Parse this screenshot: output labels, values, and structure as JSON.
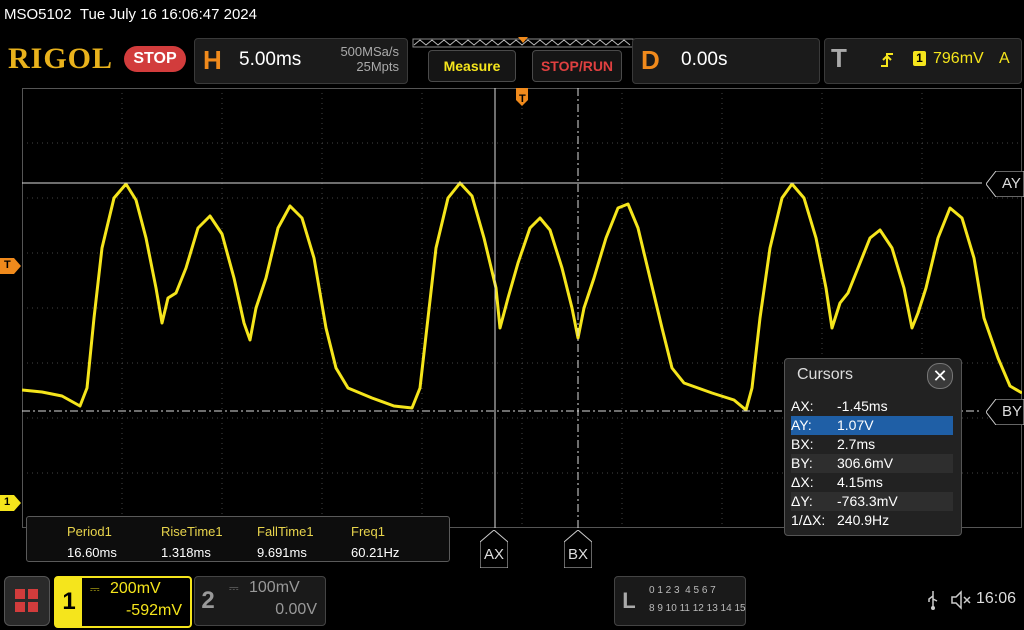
{
  "status": {
    "model": "MSO5102",
    "datetime": "Tue July 16 16:06:47 2024"
  },
  "header": {
    "brand": "RIGOL",
    "run_state": "STOP",
    "horizontal": {
      "letter": "H",
      "timebase": "5.00ms",
      "sample_rate": "500MSa/s",
      "memory_depth": "25Mpts"
    },
    "measure_label": "Measure",
    "stoprun_label": "STOP/RUN",
    "delay": {
      "letter": "D",
      "value": "0.00s"
    },
    "trigger": {
      "letter": "T",
      "source": "1",
      "level": "796mV",
      "mode": "A"
    }
  },
  "screen": {
    "trigger_marker_top": "T",
    "trigger_level_marker": "T",
    "channel1_marker": "1",
    "cursor_labels": {
      "ay": "AY",
      "by": "BY",
      "ax": "AX",
      "bx": "BX"
    }
  },
  "measurements": {
    "items": [
      {
        "label": "Period1",
        "value": "16.60ms"
      },
      {
        "label": "RiseTime1",
        "value": "1.318ms"
      },
      {
        "label": "FallTime1",
        "value": "9.691ms"
      },
      {
        "label": "Freq1",
        "value": "60.21Hz"
      }
    ]
  },
  "cursors": {
    "title": "Cursors",
    "rows": [
      {
        "label": "AX:",
        "value": "-1.45ms"
      },
      {
        "label": "AY:",
        "value": "1.07V"
      },
      {
        "label": "BX:",
        "value": "2.7ms"
      },
      {
        "label": "BY:",
        "value": "306.6mV"
      },
      {
        "label": "ΔX:",
        "value": "4.15ms"
      },
      {
        "label": "ΔY:",
        "value": "-763.3mV"
      },
      {
        "label": "1/ΔX:",
        "value": "240.9Hz"
      }
    ]
  },
  "bottom": {
    "ch1": {
      "number": "1",
      "scale": "200mV",
      "offset": "-592mV"
    },
    "ch2": {
      "number": "2",
      "scale": "100mV",
      "offset": "0.00V"
    },
    "logic": {
      "letter": "L",
      "row1": "0 1 2 3  4 5 6 7",
      "row2": "8 9 10 11 12 13 14 15"
    },
    "time": "16:06"
  },
  "colors": {
    "ch1": "#f5e51c",
    "accent": "#f08a1c",
    "stop": "#d23c3c",
    "selected_row": "#1f5fa6"
  }
}
